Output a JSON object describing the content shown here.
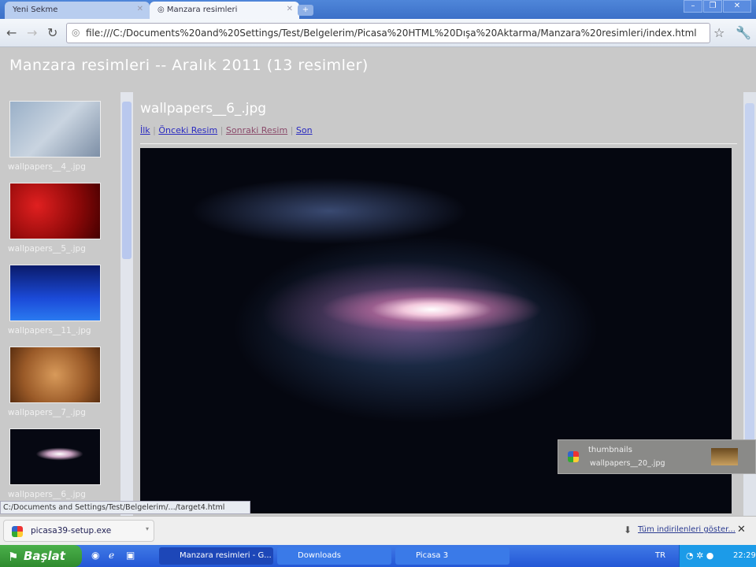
{
  "browser": {
    "tabs": [
      {
        "label": "Yeni Sekme",
        "active": false
      },
      {
        "label": "Manzara resimleri",
        "active": true
      }
    ],
    "address": "file:///C:/Documents%20and%20Settings/Test/Belgelerim/Picasa%20HTML%20Dışa%20Aktarma/Manzara%20resimleri/index.html",
    "status_url": "C:/Documents and Settings/Test/Belgelerim/.../target4.html"
  },
  "page": {
    "title": "Manzara resimleri -- Aralık 2011 (13 resimler)",
    "thumbnails": [
      {
        "label": "wallpapers__4_.jpg"
      },
      {
        "label": "wallpapers__5_.jpg"
      },
      {
        "label": "wallpapers__11_.jpg"
      },
      {
        "label": "wallpapers__7_.jpg"
      },
      {
        "label": "wallpapers__6_.jpg"
      }
    ],
    "image_title": "wallpapers__6_.jpg",
    "nav": {
      "first": "İlk",
      "prev": "Önceki Resim",
      "next": "Sonraki Resim",
      "last": "Son",
      "separator": "|"
    }
  },
  "notification": {
    "title": "thumbnails",
    "file": "wallpapers__20_.jpg"
  },
  "downloads": {
    "item": "picasa39-setup.exe",
    "show_all": "Tüm indirilenleri göster...",
    "close": "✕"
  },
  "taskbar": {
    "start": "Başlat",
    "tasks": [
      "Manzara resimleri - G...",
      "Downloads",
      "Picasa 3"
    ],
    "lang": "TR",
    "clock": "22:29"
  }
}
